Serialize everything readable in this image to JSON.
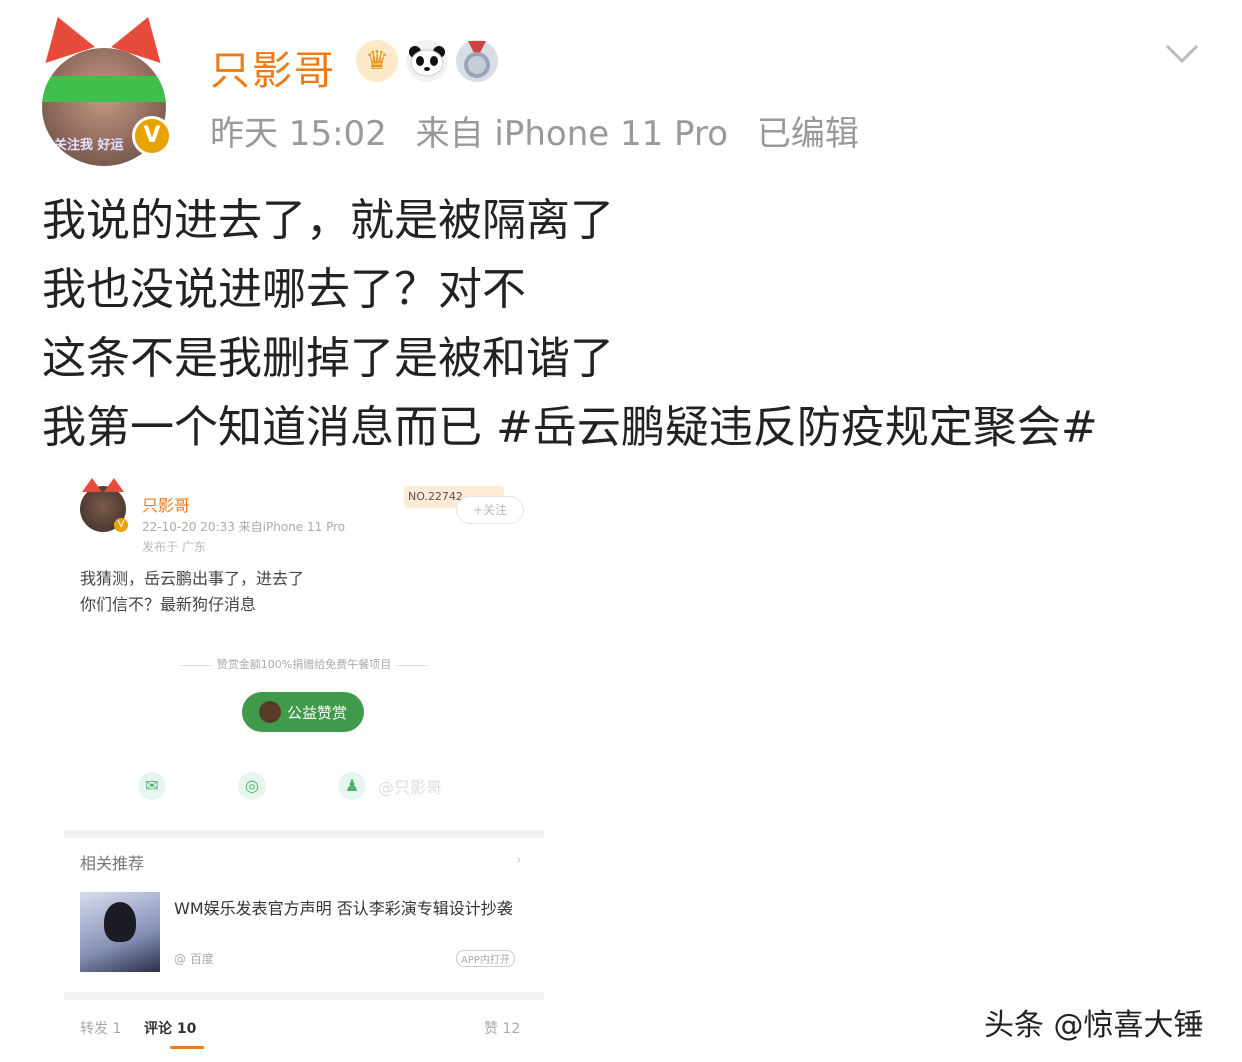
{
  "user": {
    "name": "只影哥",
    "avatar_caption": "关注我 好运",
    "verified_mark": "V",
    "badges": [
      "crown-icon",
      "panda-icon",
      "medal-icon"
    ]
  },
  "meta": {
    "time": "昨天 15:02",
    "source": "来自 iPhone 11 Pro",
    "edited": "已编辑"
  },
  "post_lines": [
    "我说的进去了，就是被隔离了",
    "我也没说进哪去了？对不",
    "这条不是我删掉了是被和谐了",
    "我第一个知道消息而已 #岳云鹏疑违反防疫规定聚会#"
  ],
  "embedded": {
    "name": "只影哥",
    "meta": "22-10-20 20:33  来自iPhone 11 Pro",
    "location": "发布于 广东",
    "no_badge": "NO.22742",
    "follow": "+关注",
    "text_lines": [
      "我猜测，岳云鹏出事了，进去了",
      "你们信不？最新狗仔消息"
    ],
    "reward_note": "赞赏金额100%捐赠给免费午餐项目",
    "reward_button": "公益赞赏",
    "watermark": "@只影哥",
    "related_title": "相关推荐",
    "related_arrow": "›",
    "news_title": "WM娱乐发表官方声明 否认李彩演专辑设计抄袭",
    "news_source": "@ 百度",
    "app_open": "APP内打开",
    "tabs": {
      "repost": "转发 1",
      "comment": "评论 10",
      "like": "赞 12"
    }
  },
  "footer": "头条 @惊喜大锤",
  "colors": {
    "username": "#f07a16",
    "meta": "#999999",
    "green": "#3f9a4b"
  }
}
